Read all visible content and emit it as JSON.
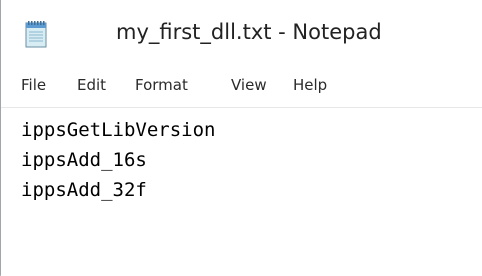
{
  "window": {
    "title": "my_first_dll.txt - Notepad",
    "app_icon": "notepad-icon"
  },
  "menubar": {
    "items": [
      {
        "label": "File"
      },
      {
        "label": "Edit"
      },
      {
        "label": "Format"
      },
      {
        "label": "View"
      },
      {
        "label": "Help"
      }
    ]
  },
  "editor": {
    "lines": [
      "ippsGetLibVersion",
      "ippsAdd_16s",
      "ippsAdd_32f"
    ]
  }
}
